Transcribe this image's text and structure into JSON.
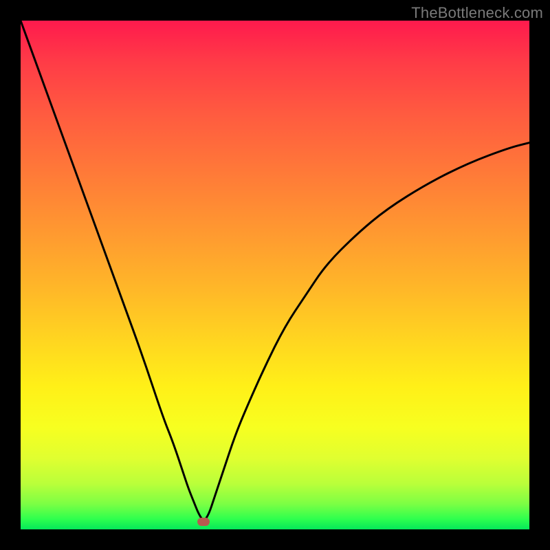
{
  "watermark": {
    "text": "TheBottleneck.com"
  },
  "colors": {
    "frame": "#000000",
    "gradient_stops": [
      "#ff1a4d",
      "#ff3b47",
      "#ff5a40",
      "#ff7a38",
      "#ff9a30",
      "#ffb828",
      "#ffd620",
      "#fff018",
      "#f7ff20",
      "#e0ff30",
      "#baff3a",
      "#7cff44",
      "#2dff4e",
      "#05e85a"
    ],
    "curve": "#000000",
    "marker": "#b75a50"
  },
  "chart_data": {
    "type": "line",
    "title": "",
    "xlabel": "",
    "ylabel": "",
    "xlim": [
      0,
      100
    ],
    "ylim": [
      0,
      100
    ],
    "grid": false,
    "legend": false,
    "annotations": [
      {
        "name": "min-marker",
        "x": 36,
        "y": 1.5
      }
    ],
    "series": [
      {
        "name": "bottleneck-curve",
        "x": [
          0,
          4,
          8,
          12,
          16,
          20,
          24,
          28,
          30,
          32,
          33,
          34,
          35,
          36,
          37,
          38,
          40,
          42,
          44,
          48,
          52,
          56,
          60,
          66,
          72,
          80,
          88,
          96,
          100
        ],
        "y": [
          100,
          89,
          78,
          67,
          56,
          45,
          34,
          22,
          17,
          11,
          8,
          5.5,
          3,
          1.5,
          3,
          6,
          12,
          18,
          23,
          32,
          40,
          46,
          52,
          58,
          63,
          68,
          72,
          75,
          76
        ]
      }
    ]
  }
}
